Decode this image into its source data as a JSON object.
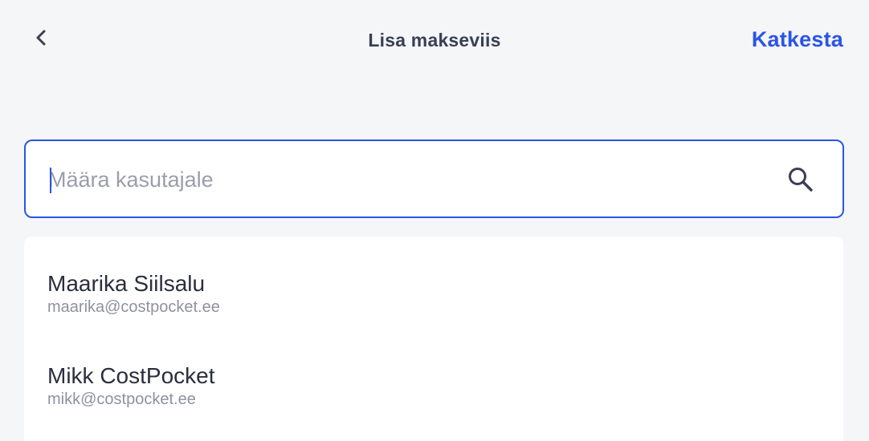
{
  "header": {
    "back_icon": "chevron-left-icon",
    "title": "Lisa makseviis",
    "cancel_label": "Katkesta"
  },
  "search": {
    "placeholder": "Määra kasutajale",
    "value": "",
    "icon": "search-icon"
  },
  "results": [
    {
      "name": "Maarika Siilsalu",
      "email": "maarika@costpocket.ee"
    },
    {
      "name": "Mikk CostPocket",
      "email": "mikk@costpocket.ee"
    }
  ],
  "colors": {
    "accent": "#2a55e5",
    "background": "#f5f6f8",
    "title": "#3a3f55",
    "muted": "#8d92a0"
  }
}
